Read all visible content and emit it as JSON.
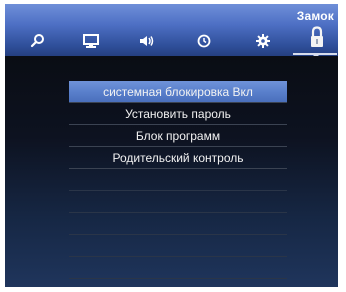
{
  "header": {
    "title": "Замок",
    "tabs": [
      {
        "id": "search",
        "icon": "search-icon"
      },
      {
        "id": "picture",
        "icon": "monitor-icon"
      },
      {
        "id": "sound",
        "icon": "speaker-icon"
      },
      {
        "id": "time",
        "icon": "clock-icon"
      },
      {
        "id": "settings",
        "icon": "gear-icon"
      },
      {
        "id": "lock",
        "icon": "lock-icon",
        "active": true
      }
    ]
  },
  "menu": {
    "items": [
      {
        "label": "системная блокировка Вкл",
        "selected": true
      },
      {
        "label": "Установить пароль"
      },
      {
        "label": "Блок программ"
      },
      {
        "label": "Родительский контроль"
      }
    ]
  },
  "colors": {
    "accent": "#5a80cc",
    "topbar": "#4d6fc4",
    "background": "#0b0f17"
  }
}
